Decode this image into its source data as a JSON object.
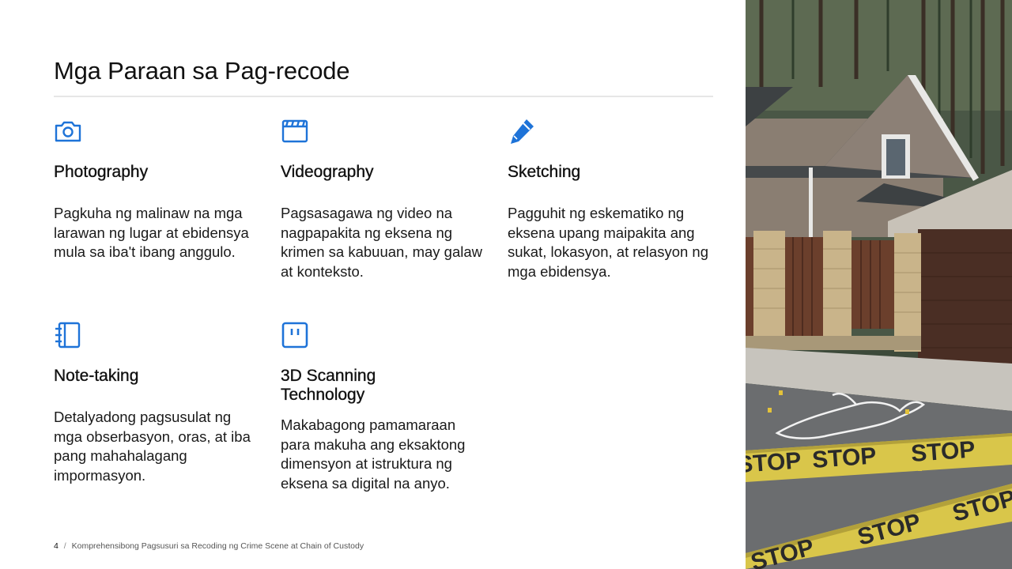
{
  "slide": {
    "title": "Mga Paraan sa Pag-recode",
    "accent_color": "#1e73d8"
  },
  "methods": [
    {
      "icon": "camera-icon",
      "title": "Photography",
      "description": "Pagkuha ng malinaw na mga larawan ng lugar at ebidensya mula sa iba't ibang anggulo."
    },
    {
      "icon": "clapperboard-icon",
      "title": "Videography",
      "description": "Pagsasagawa ng video na nagpapakita ng eksena ng krimen sa kabuuan, may galaw at konteksto."
    },
    {
      "icon": "pencil-icon",
      "title": "Sketching",
      "description": "Pagguhit ng eskematiko ng eksena upang maipakita ang sukat, lokasyon, at relasyon ng mga ebidensya."
    },
    {
      "icon": "notebook-icon",
      "title": "Note-taking",
      "description": "Detalyadong pagsusulat ng mga obserbasyon, oras, at iba pang mahahalagang impormasyon."
    },
    {
      "icon": "pause-square-icon",
      "title": "3D Scanning Technology",
      "description": "Makabagong pamamaraan para makuha ang eksaktong dimensyon at istruktura ng eksena sa digital na anyo."
    }
  ],
  "photo": {
    "tape_text": "STOP"
  },
  "footer": {
    "page_number": "4",
    "separator": "/",
    "text": "Komprehensibong Pagsusuri sa Recoding ng Crime Scene at Chain of Custody"
  }
}
